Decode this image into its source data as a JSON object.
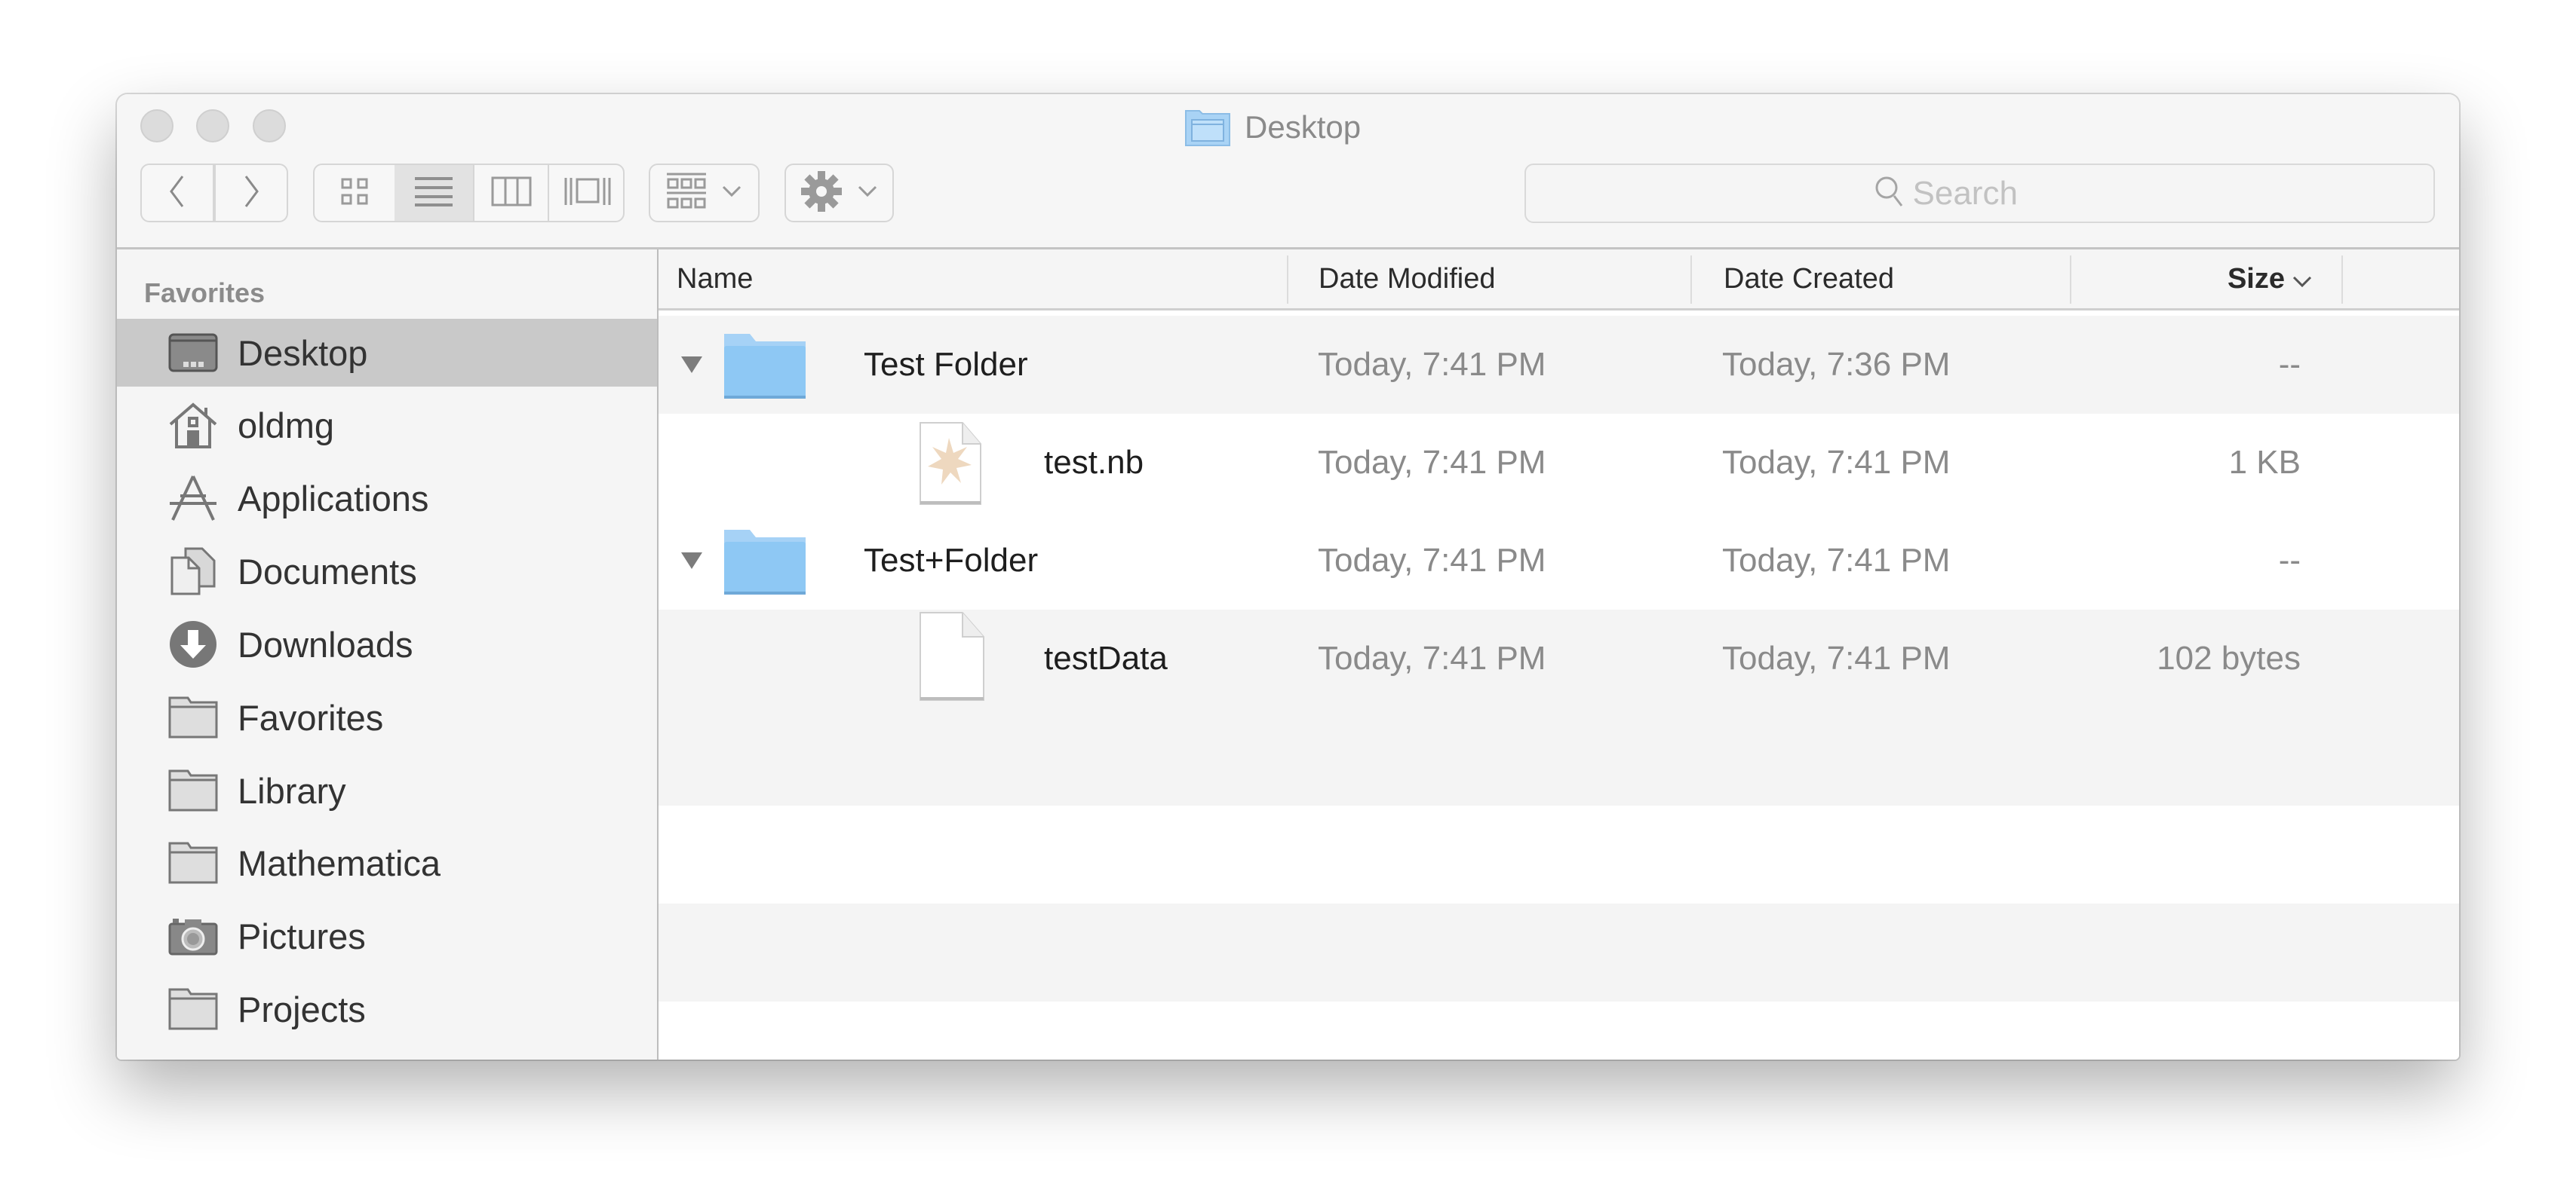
{
  "window": {
    "title": "Desktop",
    "title_icon": "desktop-folder-icon"
  },
  "toolbar": {
    "back_icon": "chevron-left-icon",
    "forward_icon": "chevron-right-icon",
    "view_modes": [
      {
        "name": "icon-view",
        "icon": "grid-icon",
        "active": false
      },
      {
        "name": "list-view",
        "icon": "list-icon",
        "active": true
      },
      {
        "name": "column-view",
        "icon": "columns-icon",
        "active": false
      },
      {
        "name": "cover-flow-view",
        "icon": "cover-flow-icon",
        "active": false
      }
    ],
    "arrange_icon": "arrange-grid-icon",
    "action_icon": "gear-icon",
    "search_placeholder": "Search"
  },
  "sidebar": {
    "section_title": "Favorites",
    "items": [
      {
        "label": "Desktop",
        "icon": "desktop-icon",
        "selected": true
      },
      {
        "label": "oldmg",
        "icon": "home-icon",
        "selected": false
      },
      {
        "label": "Applications",
        "icon": "applications-icon",
        "selected": false
      },
      {
        "label": "Documents",
        "icon": "documents-icon",
        "selected": false
      },
      {
        "label": "Downloads",
        "icon": "downloads-icon",
        "selected": false
      },
      {
        "label": "Favorites",
        "icon": "folder-icon",
        "selected": false
      },
      {
        "label": "Library",
        "icon": "folder-icon",
        "selected": false
      },
      {
        "label": "Mathematica",
        "icon": "folder-icon",
        "selected": false
      },
      {
        "label": "Pictures",
        "icon": "camera-icon",
        "selected": false
      },
      {
        "label": "Projects",
        "icon": "folder-icon",
        "selected": false
      }
    ]
  },
  "list": {
    "columns": {
      "name": "Name",
      "date_modified": "Date Modified",
      "date_created": "Date Created",
      "size": "Size"
    },
    "sort_column": "size",
    "sort_direction": "descending",
    "rows": [
      {
        "name": "Test Folder",
        "kind": "folder",
        "expanded": true,
        "level": 0,
        "date_modified": "Today, 7:41 PM",
        "date_created": "Today, 7:36 PM",
        "size": "--"
      },
      {
        "name": "test.nb",
        "kind": "notebook",
        "level": 1,
        "date_modified": "Today, 7:41 PM",
        "date_created": "Today, 7:41 PM",
        "size": "1 KB"
      },
      {
        "name": "Test+Folder",
        "kind": "folder",
        "expanded": true,
        "level": 0,
        "date_modified": "Today, 7:41 PM",
        "date_created": "Today, 7:41 PM",
        "size": "--"
      },
      {
        "name": "testData",
        "kind": "document",
        "level": 1,
        "date_modified": "Today, 7:41 PM",
        "date_created": "Today, 7:41 PM",
        "size": "102 bytes"
      }
    ]
  },
  "colors": {
    "folder_blue": "#8ec8f4",
    "selection_gray": "#c9c9c9",
    "sidebar_bg": "#f5f5f5"
  }
}
